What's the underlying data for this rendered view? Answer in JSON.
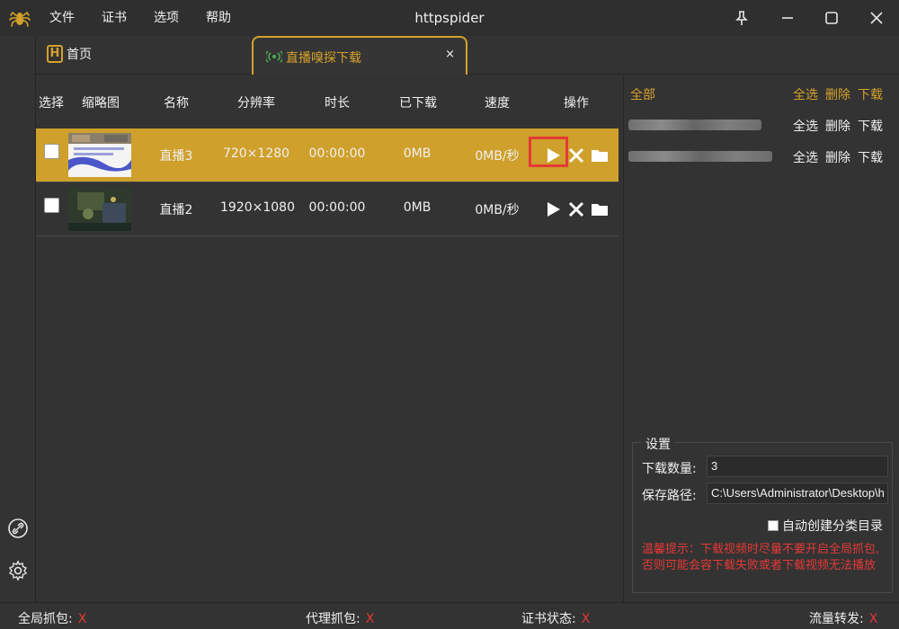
{
  "titlebar": {
    "app_title": "httpspider",
    "menus": [
      "文件",
      "证书",
      "选项",
      "帮助"
    ]
  },
  "tabs": {
    "home_label": "首页",
    "live_label": "直播嗅探下载",
    "close_glyph": "×"
  },
  "table": {
    "headers": [
      "选择",
      "缩略图",
      "名称",
      "分辨率",
      "时长",
      "已下载",
      "速度",
      "操作"
    ],
    "rows": [
      {
        "name": "直播3",
        "resolution": "720×1280",
        "duration": "00:00:00",
        "downloaded": "0MB",
        "speed": "0MB/秒",
        "selected": true
      },
      {
        "name": "直播2",
        "resolution": "1920×1080",
        "duration": "00:00:00",
        "downloaded": "0MB",
        "speed": "0MB/秒",
        "selected": false
      }
    ]
  },
  "right_panel": {
    "groups": [
      {
        "label": "全部",
        "select_all": "全选",
        "delete": "删除",
        "download": "下载"
      },
      {
        "label": "",
        "select_all": "全选",
        "delete": "删除",
        "download": "下载"
      },
      {
        "label": "",
        "select_all": "全选",
        "delete": "删除",
        "download": "下载"
      }
    ],
    "settings": {
      "legend": "设置",
      "download_count_label": "下载数量:",
      "download_count_value": "3",
      "save_path_label": "保存路径:",
      "save_path_value": "C:\\Users\\Administrator\\Desktop\\h",
      "auto_dir_label": "自动创建分类目录",
      "warning": "温馨提示：下载视频时尽量不要开启全局抓包,否则可能会容下载失败或者下载视频无法播放"
    }
  },
  "statusbar": {
    "global_capture": "全局抓包:",
    "proxy_capture": "代理抓包:",
    "cert_status": "证书状态:",
    "traffic_forward": "流量转发:",
    "off_mark": "X"
  },
  "colors": {
    "accent": "#d4a22b",
    "selected_row": "#cfa02b",
    "warning": "#e53935",
    "background": "#333333"
  }
}
